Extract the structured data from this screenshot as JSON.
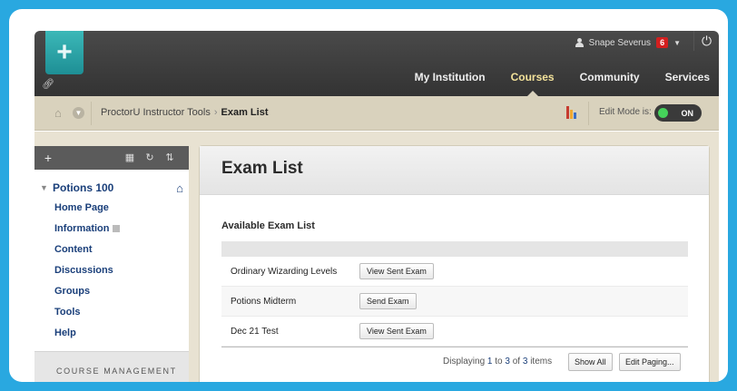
{
  "topbar": {
    "user_name": "Snape Severus",
    "notification_count": "6",
    "nav": [
      "My Institution",
      "Courses",
      "Community",
      "Services"
    ],
    "active_nav": "Courses"
  },
  "breadcrumb": {
    "items": [
      "ProctorU Instructor Tools",
      "Exam List"
    ],
    "separator": "›",
    "edit_mode_label": "Edit Mode is:",
    "edit_mode_state": "ON"
  },
  "sidebar": {
    "course_name": "Potions 100",
    "items": [
      "Home Page",
      "Information",
      "Content",
      "Discussions",
      "Groups",
      "Tools",
      "Help"
    ],
    "management_label": "COURSE MANAGEMENT"
  },
  "main": {
    "title": "Exam List",
    "section_title": "Available Exam List",
    "exams": [
      {
        "name": "Ordinary Wizarding Levels",
        "action": "View Sent Exam"
      },
      {
        "name": "Potions Midterm",
        "action": "Send Exam"
      },
      {
        "name": "Dec 21 Test",
        "action": "View Sent Exam"
      }
    ],
    "paging": {
      "prefix": "Displaying",
      "from": "1",
      "to_word": "to",
      "to": "3",
      "of_word": "of",
      "total": "3",
      "suffix": "items"
    },
    "show_all_label": "Show All",
    "edit_paging_label": "Edit Paging..."
  },
  "colors": {
    "frame_blue": "#29a8e0",
    "link_navy": "#1a3f7a",
    "active_nav": "#f3e29a",
    "toggle_on": "#45d25a",
    "badge_red": "#d21f1f"
  }
}
